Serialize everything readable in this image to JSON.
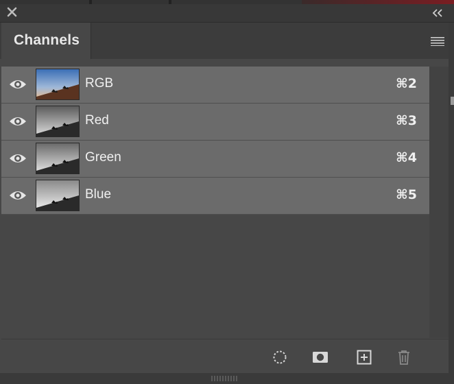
{
  "panel": {
    "tab_title": "Channels"
  },
  "channels": [
    {
      "name": "RGB",
      "shortcut": "⌘2",
      "thumb": "color"
    },
    {
      "name": "Red",
      "shortcut": "⌘3",
      "thumb": "gray"
    },
    {
      "name": "Green",
      "shortcut": "⌘4",
      "thumb": "gray"
    },
    {
      "name": "Blue",
      "shortcut": "⌘5",
      "thumb": "gray"
    }
  ],
  "icons": {
    "close": "close-icon",
    "collapse": "double-chevron-left-icon",
    "menu": "panel-menu-icon",
    "visibility": "eye-icon",
    "load_selection": "dashed-selection-icon",
    "save_selection": "mask-icon",
    "new_channel": "new-channel-icon",
    "delete": "trash-icon"
  },
  "colors": {
    "panel_bg": "#474747",
    "row_bg": "#6b6b6b",
    "text": "#f0f0f0"
  }
}
